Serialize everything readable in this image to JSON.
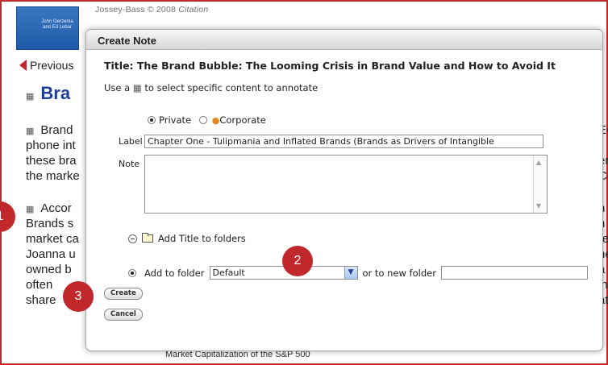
{
  "background": {
    "citation": "Jossey-Bass © 2008",
    "citation_italic": "Citation",
    "cover_text": "John Gerzema and Ed Lebar",
    "previous_label": "Previous",
    "page_title_fragment": "Bra",
    "paragraph1_lines": [
      "Brand",
      "phone int",
      "these bra",
      "the marke"
    ],
    "paragraph2_lines": [
      "Accor",
      "Brands s",
      "market ca",
      "Joanna u",
      "owned b",
      "often",
      "share"
    ],
    "right_fragments": [
      "EC",
      ",",
      "er",
      "Co",
      "",
      "n",
      "n",
      "re",
      "he",
      "a",
      "in",
      "at"
    ],
    "caption": "Market Capitalization of the S&P 500"
  },
  "dialog": {
    "header": "Create Note",
    "title": "Title: The Brand Bubble: The Looming Crisis in Brand Value and How to Avoid It",
    "hint_prefix": "Use a",
    "hint_suffix": "to select specific content to annotate",
    "private_label": "Private",
    "corporate_label": "Corporate",
    "label_caption": "Label",
    "label_value": "Chapter One - Tulipmania and Inflated Brands (Brands as Drivers of Intangible",
    "note_caption": "Note",
    "note_value": "",
    "add_title_label": "Add Title to folders",
    "add_to_folder_label": "Add to folder",
    "folder_selected": "Default",
    "or_new_folder_label": "or  to new folder",
    "new_folder_value": "",
    "create_label": "Create",
    "cancel_label": "Cancel"
  },
  "markers": [
    "1",
    "2",
    "3"
  ],
  "colors": {
    "accent": "#c0282c",
    "title_blue": "#1f3d99"
  },
  "icons": [
    "book-icon",
    "person-icon",
    "folder-icon",
    "collapse-icon",
    "dropdown-arrow-icon"
  ]
}
